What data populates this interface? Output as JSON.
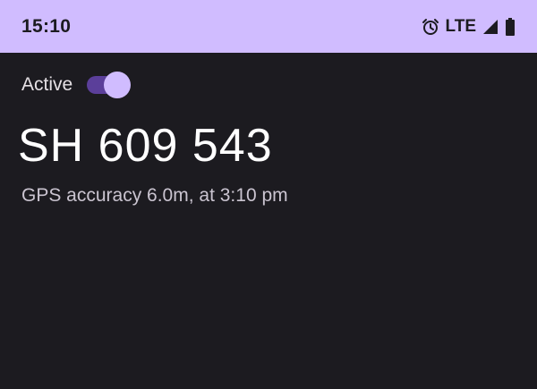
{
  "status_bar": {
    "time": "15:10",
    "network": "LTE",
    "icons": [
      "alarm-icon",
      "signal-icon",
      "battery-icon"
    ],
    "background": "#d0bcff"
  },
  "main": {
    "active_label": "Active",
    "active_toggle_on": true,
    "grid_reference": "SH 609 543",
    "accuracy_text": "GPS accuracy 6.0m, at 3:10 pm"
  },
  "colors": {
    "background": "#1c1b20",
    "accent": "#d0bcff",
    "toggle_track": "#5b3f9a"
  }
}
